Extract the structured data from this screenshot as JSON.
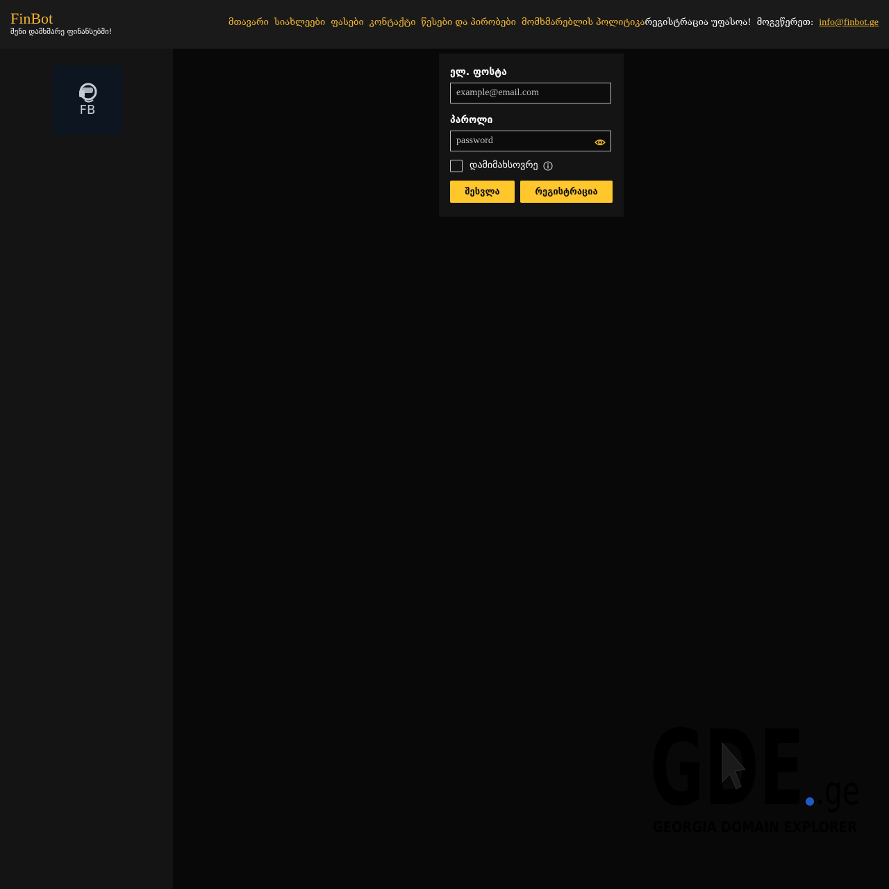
{
  "header": {
    "brand_name": "FinBot",
    "brand_tagline": "შენი დამხმარე ფინანსებში!",
    "nav_items": [
      "მთავარი",
      "სიახლეები",
      "ფასები",
      "კონტაქტი",
      "წესები და პირობები",
      "მომხმარებლის პოლიტიკა"
    ],
    "registration_text": "რეგისტრაცია უფასოა!",
    "contact_label": "მოგვწერეთ:",
    "contact_email": "info@finbot.ge"
  },
  "sidebar": {
    "logo_text": "FB"
  },
  "login": {
    "email_label": "ელ. ფოსტა",
    "email_placeholder": "example@email.com",
    "password_label": "პაროლი",
    "password_placeholder": "password",
    "remember_label": "დამიმახსოვრე",
    "login_button": "შესვლა",
    "register_button": "რეგისტრაცია"
  },
  "watermark": {
    "main": "GDE",
    "tld": ".ge",
    "subtitle": "GEORGIA DOMAIN EXPLORER"
  },
  "colors": {
    "accent": "#f5b731",
    "button": "#ffc72c",
    "background": "#080808",
    "panel": "#141414"
  }
}
